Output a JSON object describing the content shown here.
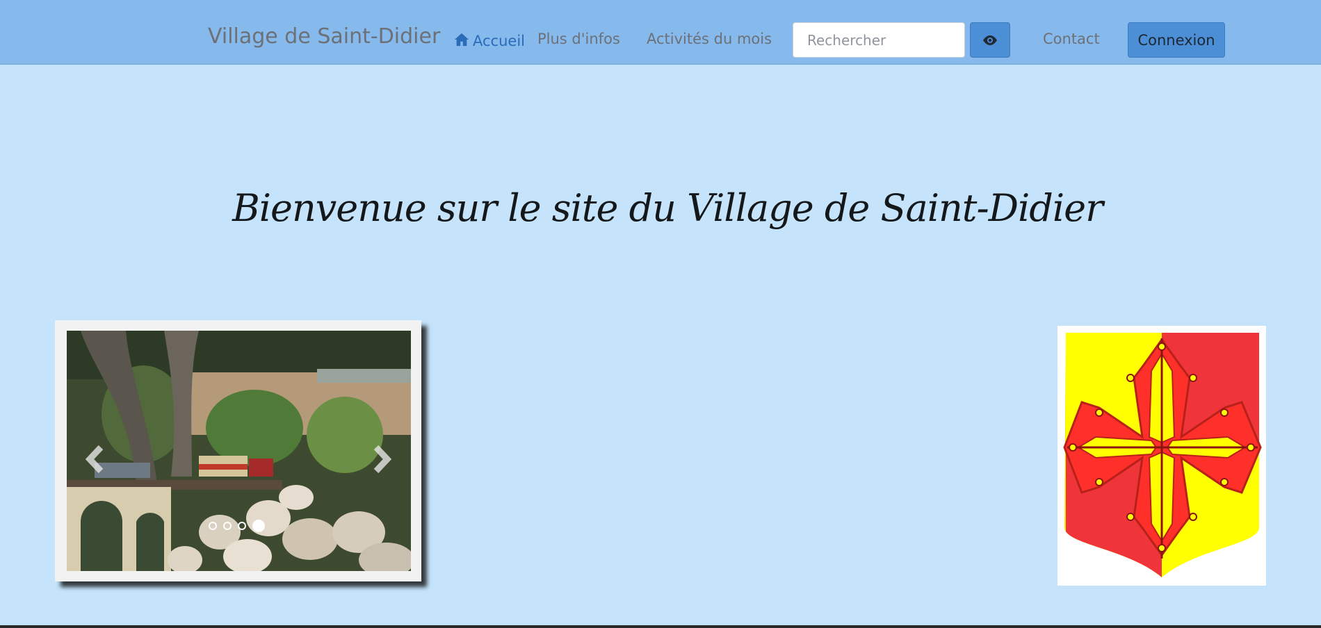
{
  "navbar": {
    "brand": "Village de Saint-Didier",
    "links": [
      {
        "label": "Accueil",
        "icon": "home-icon",
        "active": true
      },
      {
        "label": "Plus d'infos"
      },
      {
        "label": "Activités du mois"
      },
      {
        "label": "Contact"
      }
    ],
    "search": {
      "placeholder": "Rechercher",
      "value": "",
      "button_icon": "eye-icon"
    },
    "login_label": "Connexion"
  },
  "main": {
    "welcome_text": "Bienvenue sur le site du Village de Saint-Didier"
  },
  "carousel": {
    "slide_count": 4,
    "active_slide": 4,
    "prev_icon": "chevron-left-icon",
    "next_icon": "chevron-right-icon"
  },
  "colors": {
    "navbar_bg": "#86b9ec",
    "page_bg": "#c5e4fb",
    "accent": "#4c8fd6",
    "active_link": "#2a6cb7"
  }
}
